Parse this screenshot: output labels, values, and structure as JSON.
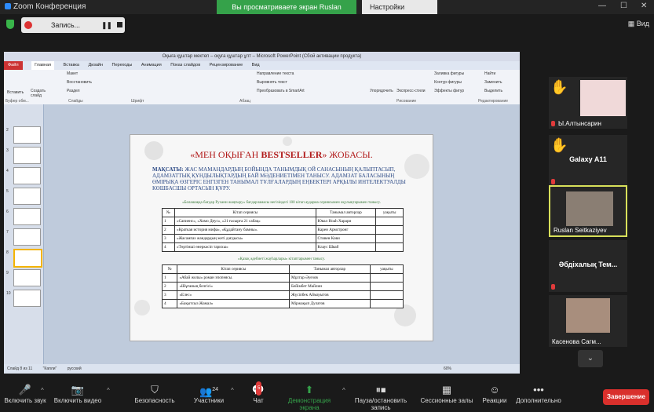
{
  "titlebar": {
    "app_title": "Zoom Конференция",
    "share_banner": "Вы просматриваете экран Ruslan Seitkaziyev",
    "view_options": "Настройки просмотра ▾"
  },
  "topbar": {
    "record_label": "Запись...",
    "view_label": "Вид"
  },
  "ppt": {
    "window_title": "Оқыға құштар мектеп – оқуға құштар ұлт – Microsoft PowerPoint (Сбой активации продукта)",
    "tabs": [
      "Файл",
      "Главная",
      "Вставка",
      "Дизайн",
      "Переходы",
      "Анимация",
      "Показ слайдов",
      "Рецензирование",
      "Вид"
    ],
    "ribbon": {
      "paste": "Вставить",
      "create_slide": "Создать слайд",
      "layout": "Макет",
      "restore": "Восстановить",
      "section": "Раздел",
      "find": "Найти",
      "replace": "Заменить",
      "select": "Выделить",
      "text_direction": "Направление текста",
      "align_text": "Выровнять текст",
      "smartart": "Преобразовать в SmartArt",
      "arrange": "Упорядочить",
      "quick_styles": "Экспресс-стили",
      "fill": "Заливка фигуры",
      "outline": "Контур фигуры",
      "effects": "Эффекты фигур",
      "groups": [
        "Буфер обм...",
        "Слайды",
        "Шрифт",
        "Абзац",
        "Рисование",
        "Редактирование"
      ]
    },
    "slide": {
      "heading_pre": "«МЕН ОҚЫҒАН ",
      "heading_bold": "BESTSELLER",
      "heading_post": "» ЖОБАСЫ.",
      "goal_label": "МАҚСАТЫ:",
      "goal_text": " ЖАС МАМАНДАРДЫҢ БОЙЫНДА ТАНЫМДЫҚ ОЙ САНАСЫНЫҢ ҚАЛЫПТАСЫП, АДАМЗАТТЫҚ ҚҰНДЫЛЫҚТАРДЫҢ БАЙ МӘДЕНИЕТІМЕН ТАНЫСУ. АДАМЗАТ БАЛАСЫНЫҢ ӨМІРЫҚА ӨЗГЕРІС ЕНГІЗГЕН ТАНЫМАЛ ТҰЛҒАЛАРДЫҢ ЕҢБЕКТЕРІ АРҚЫЛЫ ИНТЕЛЕКТУАЛДЫ КӨШБАСШЫ ОРТАСЫН ҚҰРУ.",
      "section1": "«Болашаққа бағдар Рухани жаңғыру» бағдарламасы негізіндегі 100 кітап аударма сериясымен оқулықтарымен танысу.",
      "table1_head": [
        "№",
        "Кітап сериясы",
        "Танымал авторлар",
        "уақыты"
      ],
      "table1_rows": [
        [
          "1",
          "«Сапиенс», «Хомо Деус», «21 ғасырға 21 сабақ»",
          "Ювал Ноаһ Харари",
          ""
        ],
        [
          "2",
          "«Краткая история мифа», «Құдайтану бамны».",
          "Карен Армстронг",
          ""
        ],
        [
          "3",
          "«Жасампаз жандардың жеті дағдысы»",
          "Стивен Кови",
          ""
        ],
        [
          "4",
          "«Төртінші өнеркәсіп тарихы»",
          "Клаус Шваб",
          ""
        ]
      ],
      "section2": "«Қазақ әдебиеті жауһарлары» кітаптарымен танысу.",
      "table2_head": [
        "№",
        "Кітап сериясы",
        "Танымал авторлар",
        "уақыты"
      ],
      "table2_rows": [
        [
          "1",
          "«Абай жолы» роман эпопеясы.",
          "Мұхтар Әуезов",
          ""
        ],
        [
          "2",
          "«Шұғаның белгісі»",
          "Бейімбет Майлин",
          ""
        ],
        [
          "3",
          "«Елес»",
          "Жүсіпбек Аймауытов",
          ""
        ],
        [
          "4",
          "«Бақытсыз Жамал»",
          "Міржақып Дулатов",
          ""
        ]
      ]
    },
    "status": {
      "slide": "Слайд 8 из 11",
      "theme": "\"Капли\"",
      "lang": "русский",
      "zoom": "60%"
    }
  },
  "participants": [
    {
      "name": "Ы.Алтынсарин",
      "hand": true
    },
    {
      "name": "Galaxy A11",
      "hand": true
    },
    {
      "name": "Ruslan Seitkaziyev",
      "hand": false
    },
    {
      "name": "Әбдіхалық Тем...",
      "hand": false
    },
    {
      "name": "Касенова Сагм...",
      "hand": false
    }
  ],
  "toolbar": {
    "audio": "Включить звук",
    "video": "Включить видео",
    "security": "Безопасность",
    "participants": "Участники",
    "participants_count": "24",
    "chat": "Чат",
    "chat_badge": "5",
    "share": "Демонстрация экрана",
    "record": "Пауза/остановить запись",
    "rooms": "Сессионные залы",
    "reactions": "Реакции",
    "more": "Дополнительно",
    "end": "Завершение"
  },
  "colors": {
    "accent_green": "#35a24a",
    "danger": "#d9302c",
    "slide_red": "#b11a1a",
    "slide_blue": "#2c4a86"
  }
}
